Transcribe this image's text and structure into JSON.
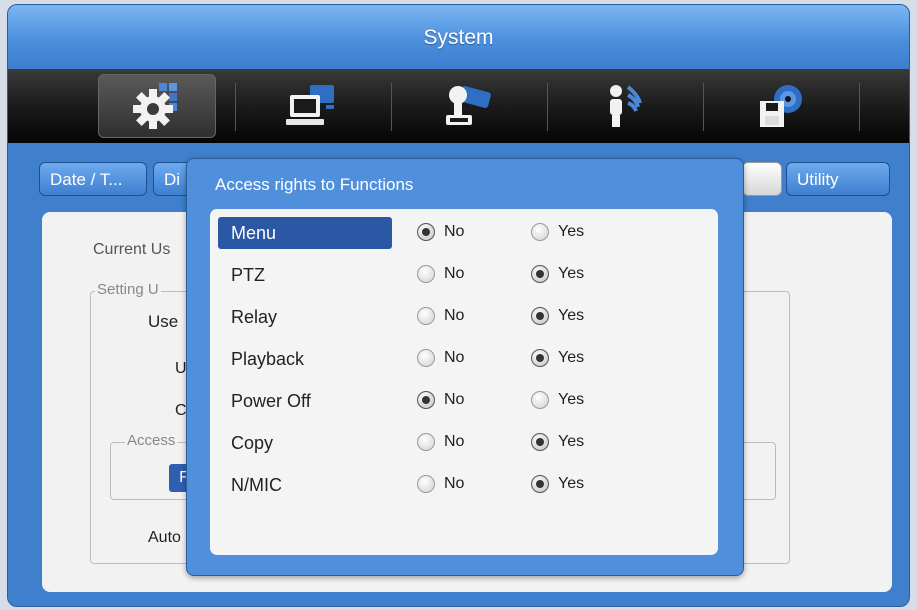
{
  "window": {
    "title": "System"
  },
  "toolbar": {
    "tools": [
      {
        "name": "settings-gear-icon"
      },
      {
        "name": "computer-network-icon"
      },
      {
        "name": "ptz-camera-icon"
      },
      {
        "name": "user-icon"
      },
      {
        "name": "disk-storage-icon"
      }
    ],
    "active_index": 0
  },
  "tabs": {
    "date_time": "Date / T...",
    "display": "Di",
    "utility": "Utility"
  },
  "background_panel": {
    "current_user_label": "Current Us",
    "setting_legend": "Setting U",
    "user_label": "Use",
    "u_label": "U",
    "c_label": "C",
    "access_legend": "Access",
    "function_button": "F",
    "auto_label": "Auto"
  },
  "dialog": {
    "title": "Access rights to Functions",
    "no_label": "No",
    "yes_label": "Yes",
    "rows": [
      {
        "label": "Menu",
        "value": "No",
        "selected": true
      },
      {
        "label": "PTZ",
        "value": "Yes",
        "selected": false
      },
      {
        "label": "Relay",
        "value": "Yes",
        "selected": false
      },
      {
        "label": "Playback",
        "value": "Yes",
        "selected": false
      },
      {
        "label": "Power Off",
        "value": "No",
        "selected": false
      },
      {
        "label": "Copy",
        "value": "Yes",
        "selected": false
      },
      {
        "label": "N/MIC",
        "value": "Yes",
        "selected": false
      }
    ]
  },
  "colors": {
    "window_blue": "#3f7fcb",
    "selected_row": "#2b58a5"
  }
}
